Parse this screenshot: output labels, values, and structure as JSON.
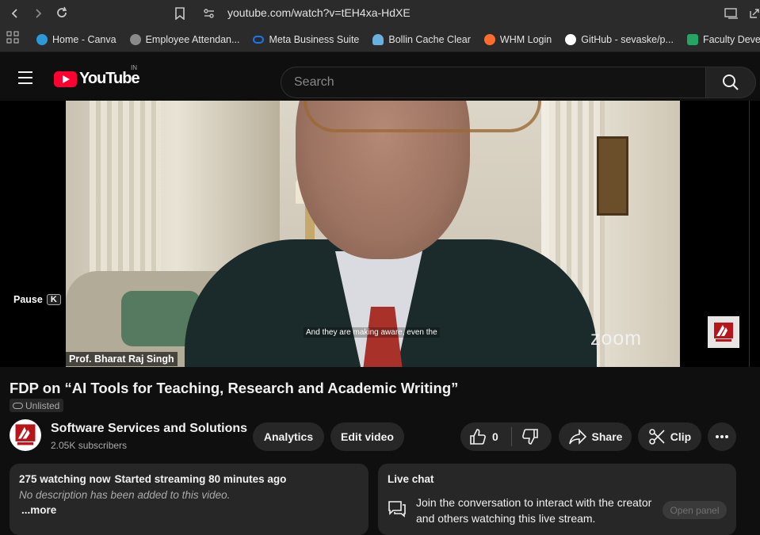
{
  "browser": {
    "url": "youtube.com/watch?v=tEH4xa-HdXE",
    "bookmarks": [
      {
        "label": "Home - Canva",
        "color": "#2a9bd8"
      },
      {
        "label": "Employee Attendan...",
        "color": "#8a8a8a"
      },
      {
        "label": "Meta Business Suite",
        "color": "#1877f2"
      },
      {
        "label": "Bollin Cache Clear",
        "color": "#6ab0de"
      },
      {
        "label": "WHM Login",
        "color": "#ff6c2c"
      },
      {
        "label": "GitHub - sevaske/p...",
        "color": "#ffffff"
      },
      {
        "label": "Faculty Develop",
        "color": "#23a566"
      }
    ]
  },
  "header": {
    "logo_text": "YouTube",
    "country_code": "IN",
    "search_placeholder": "Search"
  },
  "player": {
    "pause_label": "Pause",
    "pause_key": "K",
    "caption": "And they are making aware, even the",
    "watermark": "zoom",
    "speaker_name": "Prof. Bharat Raj Singh"
  },
  "video": {
    "title": "FDP on “AI Tools for Teaching, Research and Academic Writing”",
    "visibility": "Unlisted",
    "channel_name": "Software Services and Solutions",
    "subscribers": "2.05K subscribers",
    "analytics_label": "Analytics",
    "edit_label": "Edit video",
    "likes": "0",
    "share_label": "Share",
    "clip_label": "Clip"
  },
  "description": {
    "watching": "275 watching now",
    "started": "Started streaming 80 minutes ago",
    "empty_text": "No description has been added to this video.",
    "more_label": "...more"
  },
  "live_chat": {
    "title": "Live chat",
    "message": "Join the conversation to interact with the creator and others watching this live stream.",
    "open_label": "Open panel"
  },
  "colors": {
    "brand_red": "#ff0033",
    "background": "#0f0f0f",
    "surface": "#272727"
  }
}
